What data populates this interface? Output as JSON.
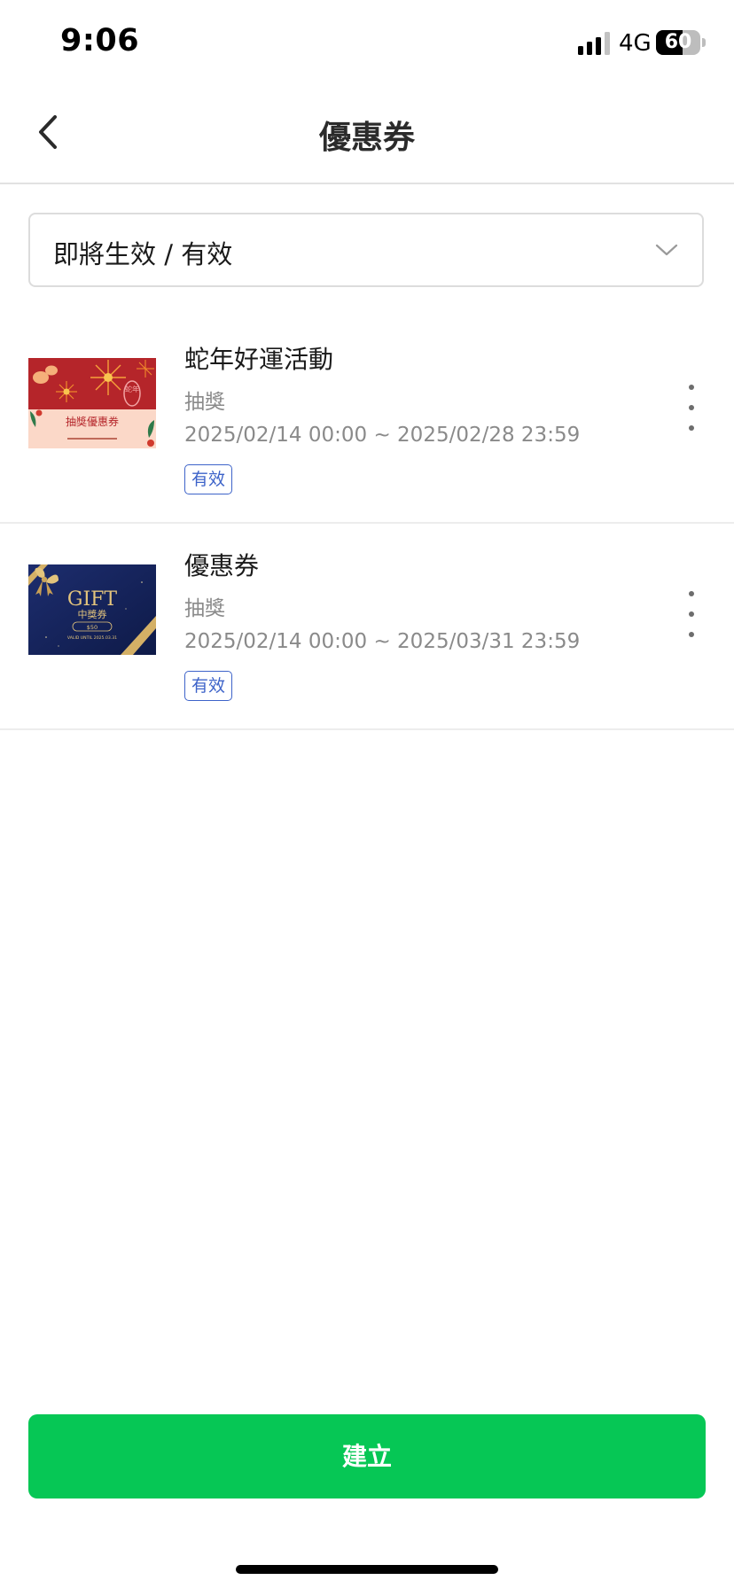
{
  "status_bar": {
    "time": "9:06",
    "network": "4G",
    "battery_level": "60",
    "battery_fraction": 0.6
  },
  "header": {
    "title": "優惠券",
    "back_icon": "chevron-left-icon"
  },
  "filter": {
    "selected_value": "即將生效 / 有效",
    "icon": "chevron-down-icon"
  },
  "coupons": [
    {
      "title": "蛇年好運活動",
      "type": "抽獎",
      "dates": "2025/02/14 00:00 ~ 2025/02/28 23:59",
      "status": "有效",
      "thumbnail": {
        "caption": "抽獎優惠券",
        "seal_text": "蛇年",
        "colors": {
          "top": "#b5252a",
          "bottom": "#fbd8c8"
        }
      }
    },
    {
      "title": "優惠券",
      "type": "抽獎",
      "dates": "2025/02/14 00:00 ~ 2025/03/31 23:59",
      "status": "有效",
      "thumbnail": {
        "headline": "GIFT",
        "subtitle": "中獎券",
        "amount": "$50",
        "valid_text": "VALID UNTIL 2025.03.31",
        "colors": {
          "background": "#14225a",
          "ribbon": "#d4b066"
        }
      }
    }
  ],
  "actions": {
    "create_label": "建立"
  },
  "theme": {
    "accent": "#06c755",
    "badge_blue": "#3d63c9"
  }
}
